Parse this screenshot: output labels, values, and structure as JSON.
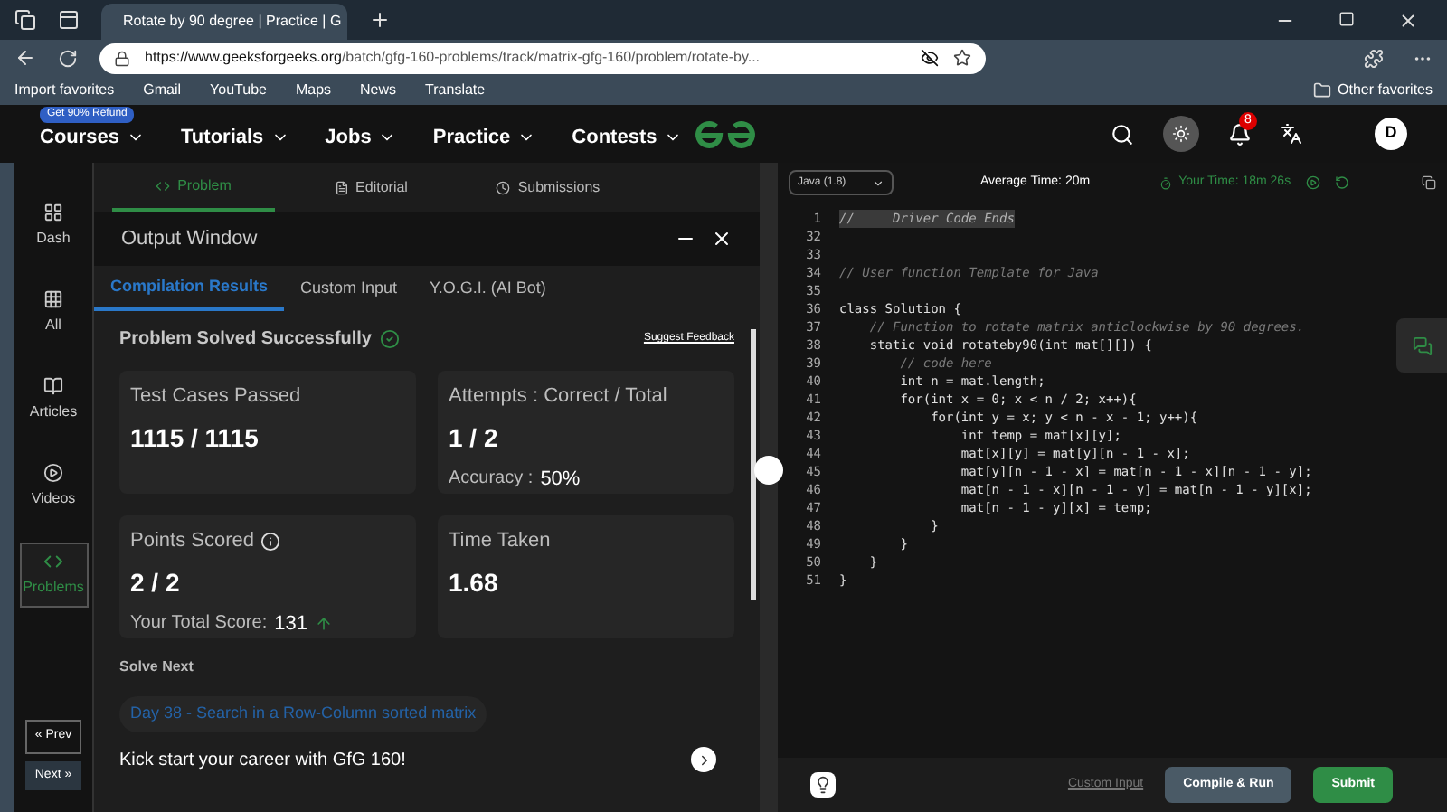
{
  "browser": {
    "tab_title": "Rotate by 90 degree | Practice | G",
    "url_host": "https://www.geeksforgeeks.org",
    "url_path": "/batch/gfg-160-problems/track/matrix-gfg-160/problem/rotate-by...",
    "favorites": [
      "Import favorites",
      "Gmail",
      "YouTube",
      "Maps",
      "News",
      "Translate"
    ],
    "other_favorites": "Other favorites"
  },
  "site_nav": {
    "badge": "Get 90% Refund",
    "menu": [
      "Courses",
      "Tutorials",
      "Jobs",
      "Practice",
      "Contests"
    ],
    "notifications": "8",
    "avatar": "D"
  },
  "sidebar": {
    "items": [
      {
        "label": "Dash",
        "selected": false
      },
      {
        "label": "All",
        "selected": false
      },
      {
        "label": "Articles",
        "selected": false
      },
      {
        "label": "Videos",
        "selected": false
      },
      {
        "label": "Problems",
        "selected": true
      }
    ],
    "prev": "« Prev",
    "next": "Next »"
  },
  "problem_tabs": [
    {
      "label": "Problem",
      "selected": true
    },
    {
      "label": "Editorial",
      "selected": false
    },
    {
      "label": "Submissions",
      "selected": false
    }
  ],
  "output_window": {
    "title": "Output Window",
    "tabs": [
      {
        "label": "Compilation Results",
        "selected": true
      },
      {
        "label": "Custom Input",
        "selected": false
      },
      {
        "label": "Y.O.G.I. (AI Bot)",
        "selected": false
      }
    ],
    "status": "Problem Solved Successfully",
    "feedback": "Suggest Feedback",
    "cards": [
      {
        "label": "Test Cases Passed",
        "value": "1115 / 1115"
      },
      {
        "label": "Attempts : Correct / Total",
        "value": "1 / 2",
        "sub_label": "Accuracy :",
        "sub_value": "50%"
      },
      {
        "label": "Points Scored",
        "value": "2 / 2",
        "sub_label": "Your Total Score:",
        "sub_value": "131",
        "info": true,
        "trend_up": true
      },
      {
        "label": "Time Taken",
        "value": "1.68"
      }
    ],
    "solve_next": {
      "heading": "Solve Next",
      "link": "Day 38 - Search in a Row-Column sorted matrix"
    },
    "promo": "Kick start your career with GfG 160!"
  },
  "editor": {
    "language": "Java (1.8)",
    "avg_time": "Average Time: 20m",
    "your_time": "Your Time: 18m 26s",
    "lines": [
      {
        "number": "1",
        "text": "//     Driver Code Ends",
        "kind": "folded"
      },
      {
        "number": "32",
        "kind": "blank"
      },
      {
        "number": "33",
        "kind": "blank"
      },
      {
        "number": "34",
        "text": "// User function Template for Java",
        "kind": "comment"
      },
      {
        "number": "35",
        "kind": "blank"
      },
      {
        "number": "36",
        "text": "class Solution {",
        "kind": "code"
      },
      {
        "number": "37",
        "text": "    // Function to rotate matrix anticlockwise by 90 degrees.",
        "kind": "comment"
      },
      {
        "number": "38",
        "text": "    static void rotateby90(int mat[][]) {",
        "kind": "code"
      },
      {
        "number": "39",
        "text": "        // code here",
        "kind": "comment"
      },
      {
        "number": "40",
        "text": "        int n = mat.length;",
        "kind": "code"
      },
      {
        "number": "41",
        "text": "        for(int x = 0; x < n / 2; x++){",
        "kind": "code"
      },
      {
        "number": "42",
        "text": "            for(int y = x; y < n - x - 1; y++){",
        "kind": "code"
      },
      {
        "number": "43",
        "text": "                int temp = mat[x][y];",
        "kind": "code"
      },
      {
        "number": "44",
        "text": "                mat[x][y] = mat[y][n - 1 - x];",
        "kind": "code"
      },
      {
        "number": "45",
        "text": "                mat[y][n - 1 - x] = mat[n - 1 - x][n - 1 - y];",
        "kind": "code"
      },
      {
        "number": "46",
        "text": "                mat[n - 1 - x][n - 1 - y] = mat[n - 1 - y][x];",
        "kind": "code"
      },
      {
        "number": "47",
        "text": "                mat[n - 1 - y][x] = temp;",
        "kind": "code"
      },
      {
        "number": "48",
        "text": "            }",
        "kind": "code"
      },
      {
        "number": "49",
        "text": "        }",
        "kind": "code"
      },
      {
        "number": "50",
        "text": "    }",
        "kind": "code"
      },
      {
        "number": "51",
        "text": "}",
        "kind": "code"
      }
    ],
    "custom_input": "Custom Input",
    "compile": "Compile & Run",
    "submit": "Submit"
  }
}
